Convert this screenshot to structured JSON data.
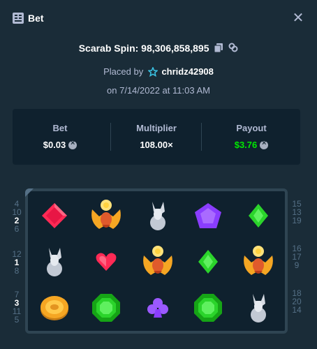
{
  "header": {
    "title": "Bet",
    "icon": "bet-slip-icon",
    "close_icon": "close-icon"
  },
  "spin": {
    "label": "Scarab Spin: 98,306,858,895"
  },
  "placed": {
    "prefix": "Placed by",
    "user": "chridz42908"
  },
  "date": "on 7/14/2022 at 11:03 AM",
  "stats": {
    "bet": {
      "label": "Bet",
      "value": "$0.03"
    },
    "multiplier": {
      "label": "Multiplier",
      "value": "108.00×"
    },
    "payout": {
      "label": "Payout",
      "value": "$3.76"
    }
  },
  "colors": {
    "background": "#1a2c38",
    "panel": "#0f212e",
    "accent_green": "#00e701",
    "muted": "#b1bad3"
  },
  "reels": [
    [
      "ruby",
      "scarab",
      "wolf",
      "amethyst",
      "emerald-small"
    ],
    [
      "wolf",
      "heart",
      "scarab",
      "emerald-small",
      "scarab"
    ],
    [
      "coin",
      "emerald",
      "club",
      "emerald",
      "wolf"
    ]
  ],
  "left_lines": [
    [
      "4",
      "10",
      "2",
      "6"
    ],
    [
      "12",
      "1",
      "8"
    ],
    [
      "7",
      "3",
      "11",
      "5"
    ]
  ],
  "right_lines": [
    [
      "15",
      "13",
      "19"
    ],
    [
      "16",
      "17",
      "9"
    ],
    [
      "18",
      "20",
      "14"
    ]
  ]
}
